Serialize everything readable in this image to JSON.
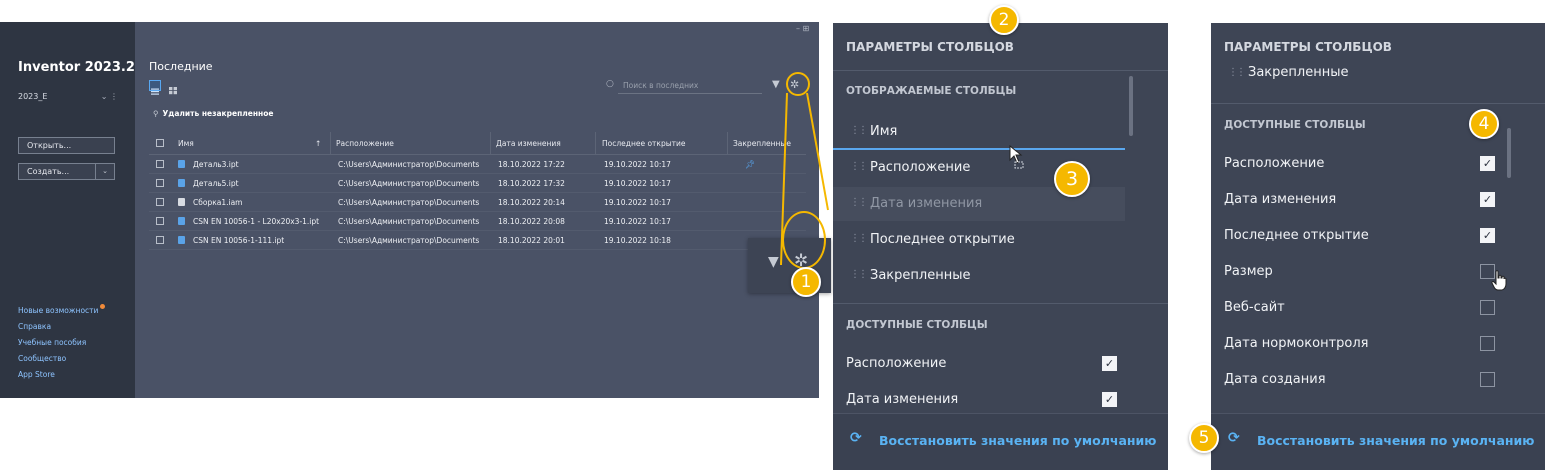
{
  "app": {
    "title": "Inventor 2023.2",
    "profile": "2023_E",
    "open_button": "Открыть...",
    "create_button": "Создать...",
    "links": [
      "Новые возможности",
      "Справка",
      "Учебные пособия",
      "Сообщество",
      "App Store"
    ]
  },
  "main": {
    "title": "Последние",
    "search_placeholder": "Поиск в последних",
    "unpin_label": "Удалить незакрепленное",
    "columns": [
      "Имя",
      "Расположение",
      "Дата изменения",
      "Последнее открытие",
      "Закрепленные"
    ],
    "rows": [
      {
        "name": "Деталь3.ipt",
        "location": "C:\\Users\\Администратор\\Documents",
        "modified": "18.10.2022 17:22",
        "opened": "19.10.2022 10:17",
        "pinned": true,
        "type": "part"
      },
      {
        "name": "Деталь5.ipt",
        "location": "C:\\Users\\Администратор\\Documents",
        "modified": "18.10.2022 17:32",
        "opened": "19.10.2022 10:17",
        "pinned": false,
        "type": "part"
      },
      {
        "name": "Сборка1.iam",
        "location": "C:\\Users\\Администратор\\Documents",
        "modified": "18.10.2022 20:14",
        "opened": "19.10.2022 10:17",
        "pinned": false,
        "type": "assembly"
      },
      {
        "name": "CSN EN 10056-1 - L20x20x3-1.ipt",
        "location": "C:\\Users\\Администратор\\Documents",
        "modified": "18.10.2022 20:08",
        "opened": "19.10.2022 10:17",
        "pinned": false,
        "type": "part"
      },
      {
        "name": "CSN EN 10056-1-111.ipt",
        "location": "C:\\Users\\Администратор\\Documents",
        "modified": "18.10.2022 20:01",
        "opened": "19.10.2022 10:18",
        "pinned": false,
        "type": "part"
      }
    ]
  },
  "panel1": {
    "title": "ПАРАМЕТРЫ СТОЛБЦОВ",
    "displayed_header": "ОТОБРАЖАЕМЫЕ СТОЛБЦЫ",
    "displayed": [
      "Имя",
      "Расположение",
      "Дата изменения",
      "Последнее открытие",
      "Закрепленные"
    ],
    "available_header": "ДОСТУПНЫЕ СТОЛБЦЫ",
    "available": [
      {
        "label": "Расположение",
        "checked": true
      },
      {
        "label": "Дата изменения",
        "checked": true
      }
    ],
    "reset": "Восстановить значения по умолчанию"
  },
  "panel2": {
    "title": "ПАРАМЕТРЫ СТОЛБЦОВ",
    "displayed_tail": "Закрепленные",
    "available_header": "ДОСТУПНЫЕ СТОЛБЦЫ",
    "available": [
      {
        "label": "Расположение",
        "checked": true
      },
      {
        "label": "Дата изменения",
        "checked": true
      },
      {
        "label": "Последнее открытие",
        "checked": true
      },
      {
        "label": "Размер",
        "checked": false
      },
      {
        "label": "Веб-сайт",
        "checked": false
      },
      {
        "label": "Дата нормоконтроля",
        "checked": false
      },
      {
        "label": "Дата создания",
        "checked": false
      }
    ],
    "reset": "Восстановить значения по умолчанию"
  },
  "callouts": [
    "1",
    "2",
    "3",
    "4",
    "5"
  ],
  "colors": {
    "accent": "#f5b800",
    "link": "#5ab3f3",
    "panel": "#3e4555",
    "app_bg": "#4a5266",
    "sidebar": "#2e3542"
  },
  "icons": [
    "gear-icon",
    "filter-icon",
    "search-icon",
    "pin-icon",
    "refresh-icon",
    "drag-grip-icon",
    "checkmark-icon",
    "hand-cursor-icon",
    "arrow-cursor-icon"
  ]
}
